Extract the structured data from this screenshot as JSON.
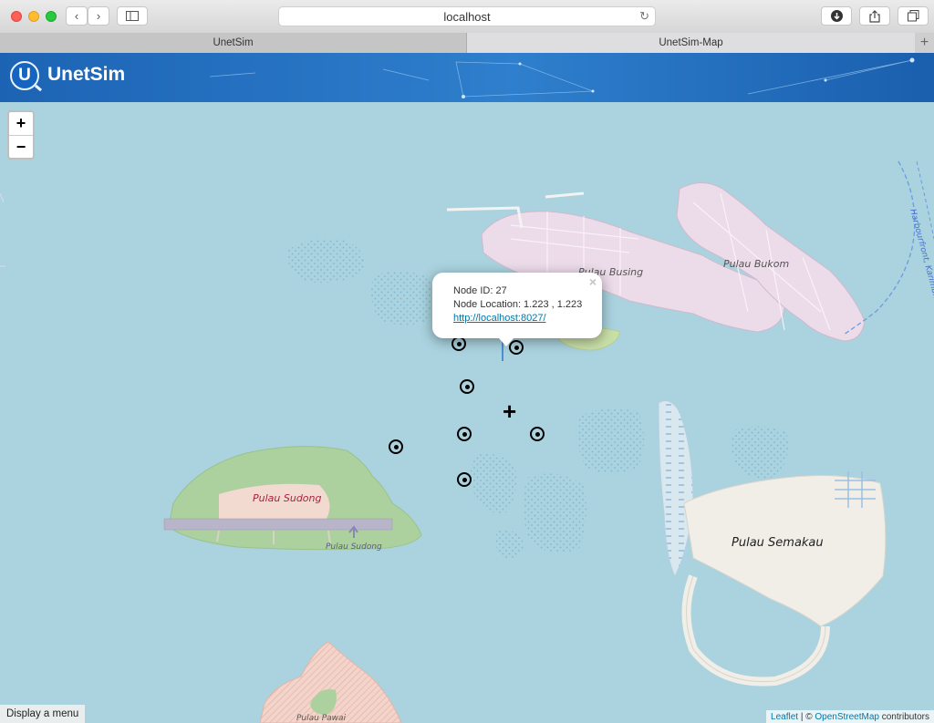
{
  "browser": {
    "url": "localhost",
    "tabs": [
      {
        "label": "UnetSim"
      },
      {
        "label": "UnetSim-Map"
      }
    ],
    "new_tab_label": "+"
  },
  "app": {
    "title": "UnetSim",
    "logo_letter": "U",
    "brand_color": "#1d63b4"
  },
  "map": {
    "zoom_in_label": "+",
    "zoom_out_label": "−",
    "labels": {
      "pulau_busing": "Pulau Busing",
      "pulau_bukom": "Pulau Bukom",
      "pulau_sudong_1": "Pulau Sudong",
      "pulau_sudong_2": "Pulau Sudong",
      "pulau_semakau": "Pulau Semakau",
      "pulau_pawai": "Pulau Pawai",
      "harbourfront": "Harbourfront, Karimun"
    },
    "water_color": "#aad3df"
  },
  "popup": {
    "node_id": "Node ID: 27",
    "node_location": "Node Location: 1.223 , 1.223",
    "link": "http://localhost:8027/",
    "close": "×"
  },
  "bottom": {
    "menu_label": "Display a menu",
    "attribution": {
      "leaflet": "Leaflet",
      "separator": " | © ",
      "osm": "OpenStreetMap",
      "contributors": " contributors"
    }
  }
}
